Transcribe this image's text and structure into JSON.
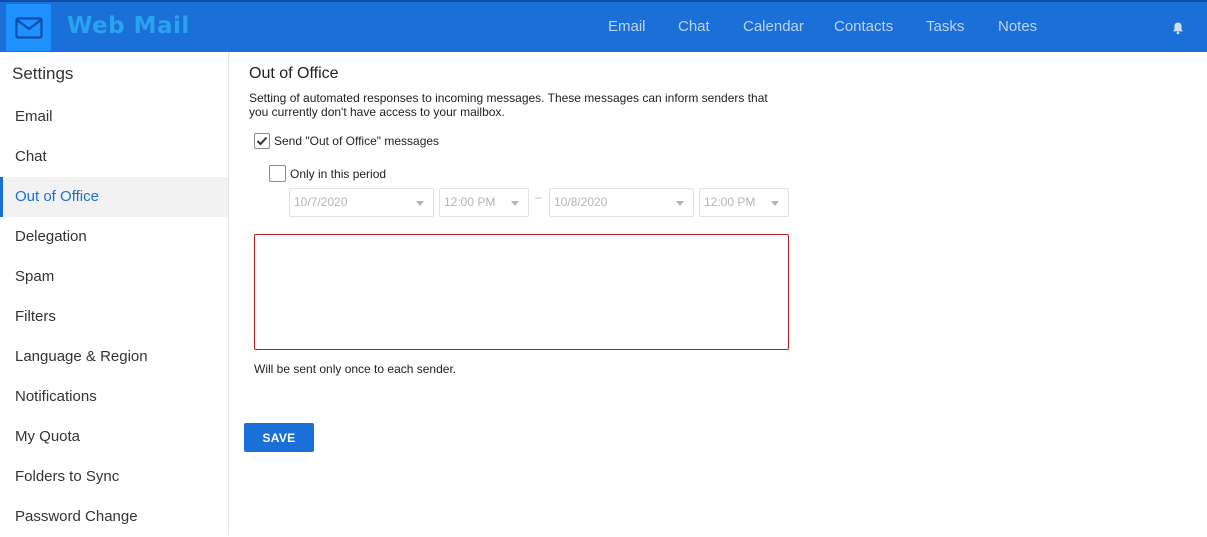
{
  "app": {
    "name": "Web Mail",
    "logo_icon": "envelope-icon"
  },
  "nav": {
    "items": [
      "Email",
      "Chat",
      "Calendar",
      "Contacts",
      "Tasks",
      "Notes"
    ],
    "notifications_icon": "bell-icon"
  },
  "sidebar": {
    "title": "Settings",
    "items": [
      "Email",
      "Chat",
      "Out of Office",
      "Delegation",
      "Spam",
      "Filters",
      "Language & Region",
      "Notifications",
      "My Quota",
      "Folders to Sync",
      "Password Change"
    ],
    "active": "Out of Office"
  },
  "content": {
    "title": "Out of Office",
    "description": "Setting of automated responses to incoming messages. These messages can inform senders that you currently don't have access to your mailbox.",
    "send_ooo_label": "Send \"Out of Office\" messages",
    "send_ooo_checked": true,
    "only_period_label": "Only in this period",
    "only_period_checked": false,
    "start_date": "10/7/2020",
    "start_time": "12:00 PM",
    "range_separator": "–",
    "end_date": "10/8/2020",
    "end_time": "12:00 PM",
    "message_value": "",
    "note": "Will be sent only once to each sender.",
    "save_label": "SAVE"
  },
  "colors": {
    "primary": "#1a6fd8",
    "error_border": "#b71c1c",
    "active_bg": "#f2f2f2"
  }
}
